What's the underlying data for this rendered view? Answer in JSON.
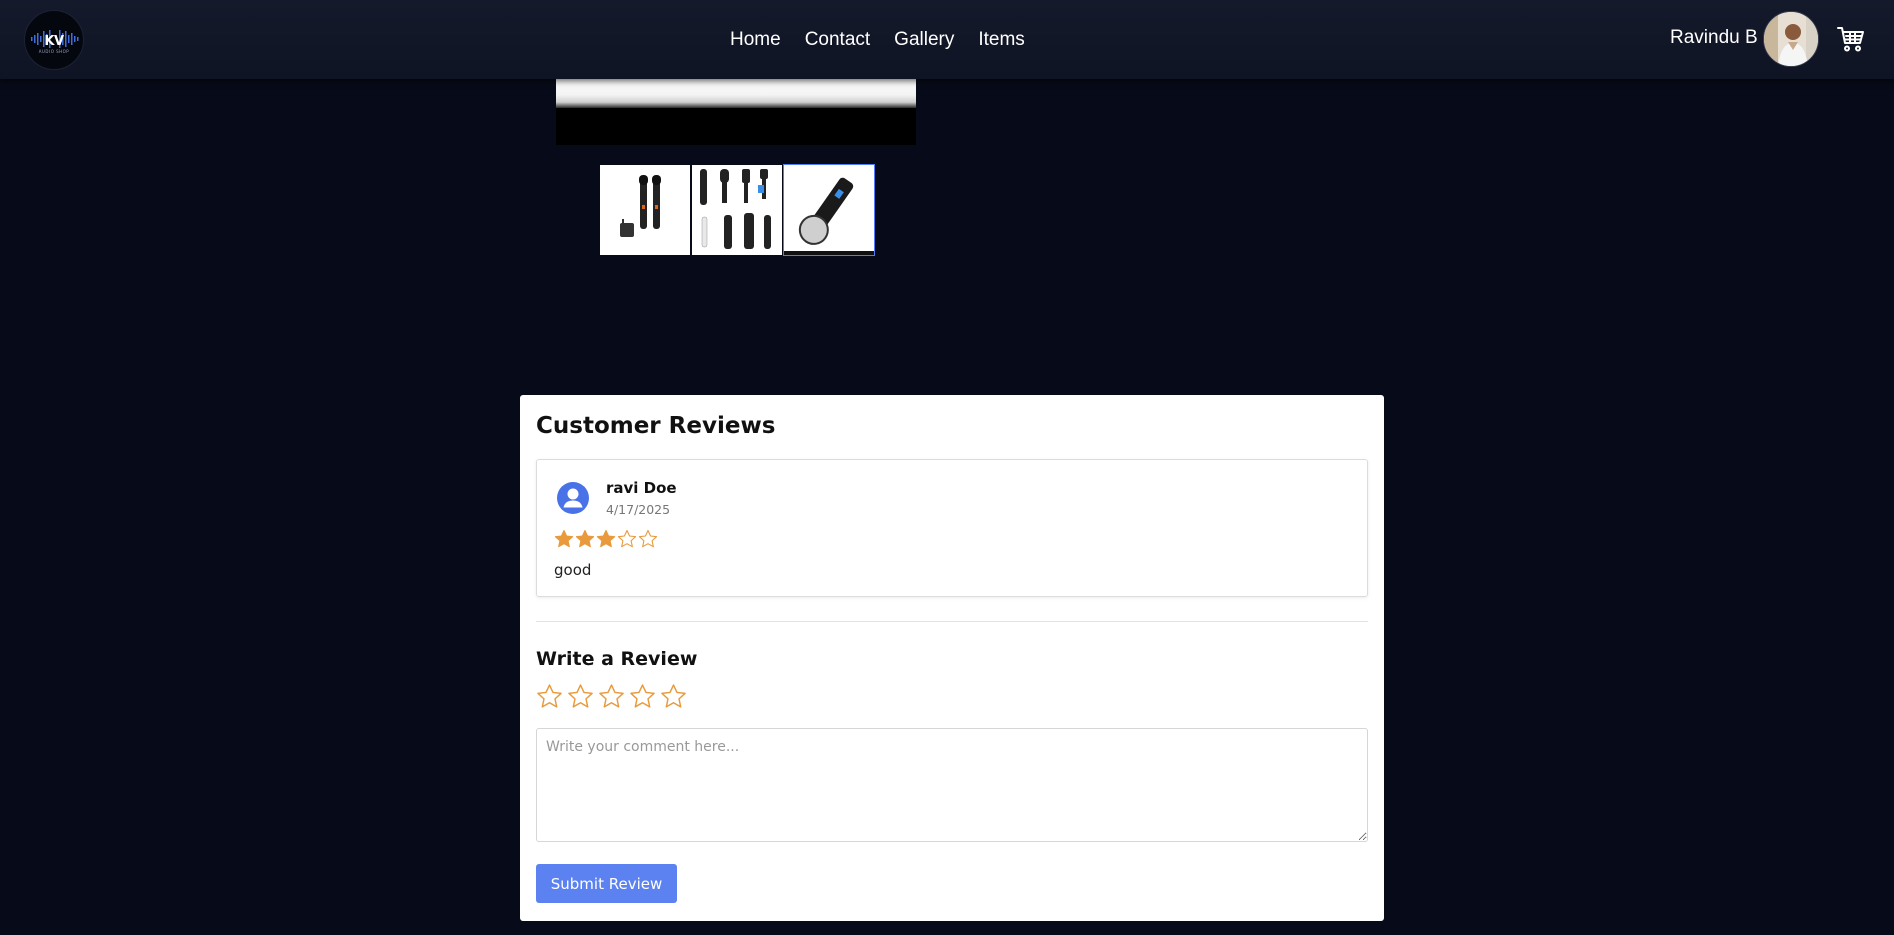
{
  "header": {
    "logo_text": "KV",
    "logo_subtext": "AUDIO SHOP",
    "nav": [
      {
        "label": "Home"
      },
      {
        "label": "Contact"
      },
      {
        "label": "Gallery"
      },
      {
        "label": "Items"
      }
    ],
    "user_name": "Ravindu B",
    "cart_icon": "cart-icon"
  },
  "product": {
    "thumbnails": [
      {
        "name": "wireless-microphone-pair"
      },
      {
        "name": "microphone-collection"
      },
      {
        "name": "handheld-microphone"
      }
    ],
    "active_thumbnail": 2
  },
  "reviews": {
    "title": "Customer Reviews",
    "items": [
      {
        "author": "ravi Doe",
        "date": "4/17/2025",
        "rating": 3,
        "max_rating": 5,
        "comment": "good"
      }
    ]
  },
  "write_review": {
    "title": "Write a Review",
    "rating": 0,
    "max_rating": 5,
    "comment_placeholder": "Write your comment here...",
    "submit_label": "Submit Review"
  },
  "colors": {
    "background": "#070a18",
    "star": "#e89a3c",
    "button": "#5b82f0",
    "reviewer_icon": "#4a72e8"
  }
}
